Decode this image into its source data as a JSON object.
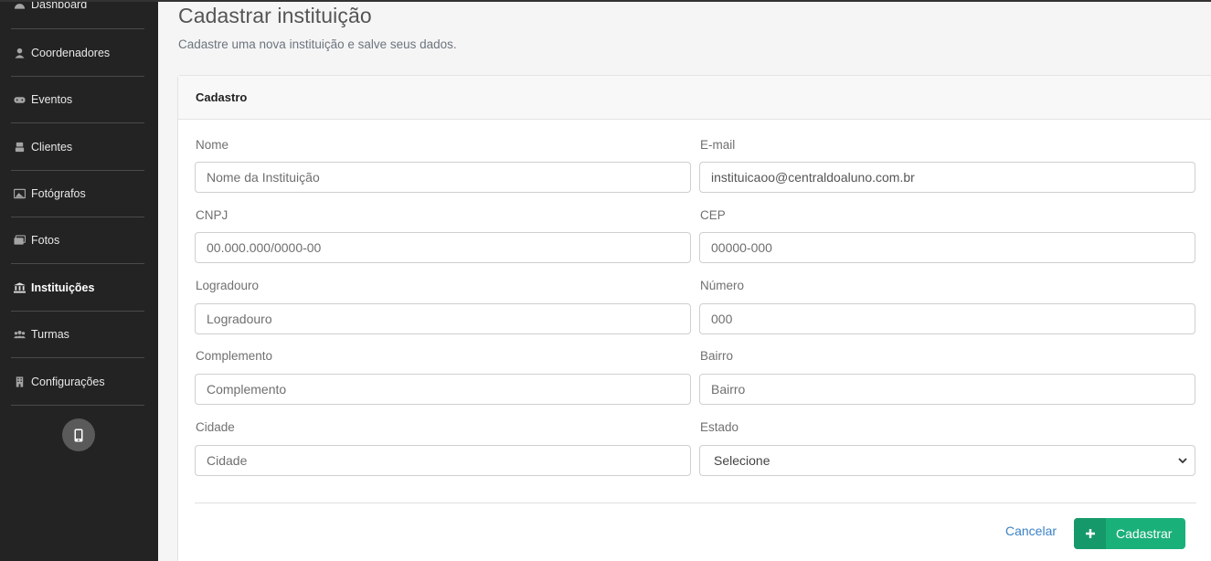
{
  "sidebar": {
    "items": [
      {
        "label": "Dashboard",
        "icon": "dashboard-icon"
      },
      {
        "label": "Coordenadores",
        "icon": "user-icon"
      },
      {
        "label": "Eventos",
        "icon": "gamepad-icon"
      },
      {
        "label": "Clientes",
        "icon": "client-icon"
      },
      {
        "label": "Fotógrafos",
        "icon": "photo-icon"
      },
      {
        "label": "Fotos",
        "icon": "images-icon"
      },
      {
        "label": "Instituições",
        "icon": "bank-icon",
        "active": true
      },
      {
        "label": "Turmas",
        "icon": "users-icon"
      },
      {
        "label": "Configurações",
        "icon": "building-icon"
      }
    ],
    "mobile_icon": "mobile-icon"
  },
  "page": {
    "title": "Cadastrar instituição",
    "subtitle": "Cadastre uma nova instituição e salve seus dados."
  },
  "card": {
    "header": "Cadastro",
    "fields": {
      "nome": {
        "label": "Nome",
        "placeholder": "Nome da Instituição",
        "value": ""
      },
      "email": {
        "label": "E-mail",
        "placeholder": "",
        "value": "instituicaoo@centraldoaluno.com.br"
      },
      "cnpj": {
        "label": "CNPJ",
        "placeholder": "00.000.000/0000-00",
        "value": ""
      },
      "cep": {
        "label": "CEP",
        "placeholder": "00000-000",
        "value": ""
      },
      "logradouro": {
        "label": "Logradouro",
        "placeholder": "Logradouro",
        "value": ""
      },
      "numero": {
        "label": "Número",
        "placeholder": "000",
        "value": ""
      },
      "complemento": {
        "label": "Complemento",
        "placeholder": "Complemento",
        "value": ""
      },
      "bairro": {
        "label": "Bairro",
        "placeholder": "Bairro",
        "value": ""
      },
      "cidade": {
        "label": "Cidade",
        "placeholder": "Cidade",
        "value": ""
      },
      "estado": {
        "label": "Estado",
        "selected": "Selecione"
      }
    },
    "actions": {
      "cancel": "Cancelar",
      "submit": "Cadastrar"
    }
  },
  "colors": {
    "sidebar_bg": "#232323",
    "submit_bg": "#1ab07a",
    "link": "#3b82c4"
  }
}
